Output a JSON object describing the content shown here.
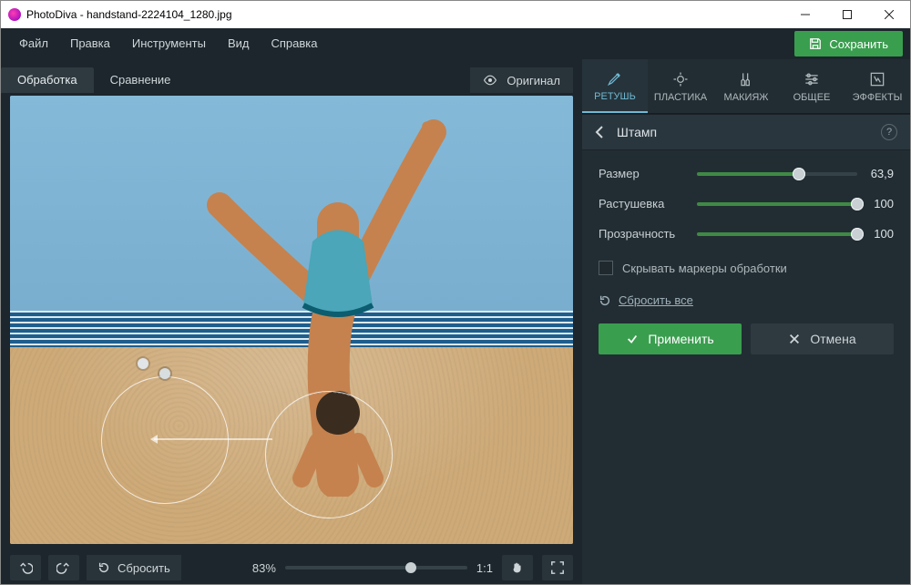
{
  "window": {
    "app_title": "PhotoDiva - handstand-2224104_1280.jpg"
  },
  "menu": {
    "file": "Файл",
    "edit": "Правка",
    "tools": "Инструменты",
    "view": "Вид",
    "help": "Справка",
    "save_label": "Сохранить"
  },
  "left": {
    "tab_processing": "Обработка",
    "tab_compare": "Сравнение",
    "original_btn": "Оригинал",
    "reset_btn": "Сбросить",
    "zoom_value": "83%",
    "ratio_label": "1:1"
  },
  "categories": {
    "retouch": "РЕТУШЬ",
    "plastic": "ПЛАСТИКА",
    "makeup": "МАКИЯЖ",
    "general": "ОБЩЕЕ",
    "effects": "ЭФФЕКТЫ"
  },
  "panel": {
    "title": "Штамп",
    "help": "?",
    "sliders": {
      "size": {
        "label": "Размер",
        "value": "63,9",
        "fill_pct": 63.9
      },
      "feather": {
        "label": "Растушевка",
        "value": "100",
        "fill_pct": 100
      },
      "opacity": {
        "label": "Прозрачность",
        "value": "100",
        "fill_pct": 100
      }
    },
    "hide_markers": "Скрывать маркеры обработки",
    "reset_all": "Сбросить все",
    "apply": "Применить",
    "cancel": "Отмена"
  }
}
